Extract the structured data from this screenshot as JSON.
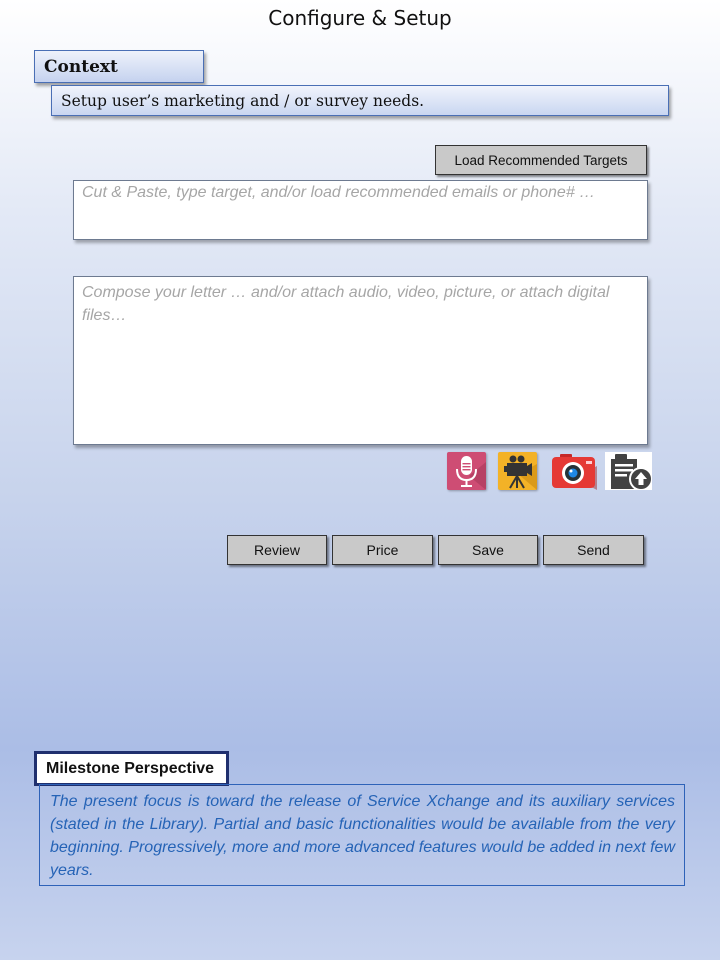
{
  "page": {
    "title": "Configure & Setup"
  },
  "context": {
    "label": "Context",
    "text": "Setup user’s marketing and / or survey needs."
  },
  "targets": {
    "load_button_label": "Load Recommended Targets",
    "placeholder": "Cut & Paste, type target, and/or load recommended emails or phone# …"
  },
  "compose": {
    "placeholder": "Compose your letter … and/or attach audio, video, picture, or attach digital files…"
  },
  "attachments": [
    {
      "icon": "microphone-icon",
      "color": "#ce4d74"
    },
    {
      "icon": "video-camera-icon",
      "color": "#f3b227"
    },
    {
      "icon": "photo-camera-icon",
      "color": "#e53935"
    },
    {
      "icon": "file-upload-icon",
      "color": "#424242"
    }
  ],
  "actions": {
    "review_label": "Review",
    "price_label": "Price",
    "save_label": "Save",
    "send_label": "Send"
  },
  "milestone": {
    "label": "Milestone Perspective",
    "text": "The present focus is toward the release of Service  Xchange and its auxiliary services (stated in the Library). Partial and basic functionalities would be available from the very beginning. Progressively, more and more advanced features would be added in next few years."
  }
}
